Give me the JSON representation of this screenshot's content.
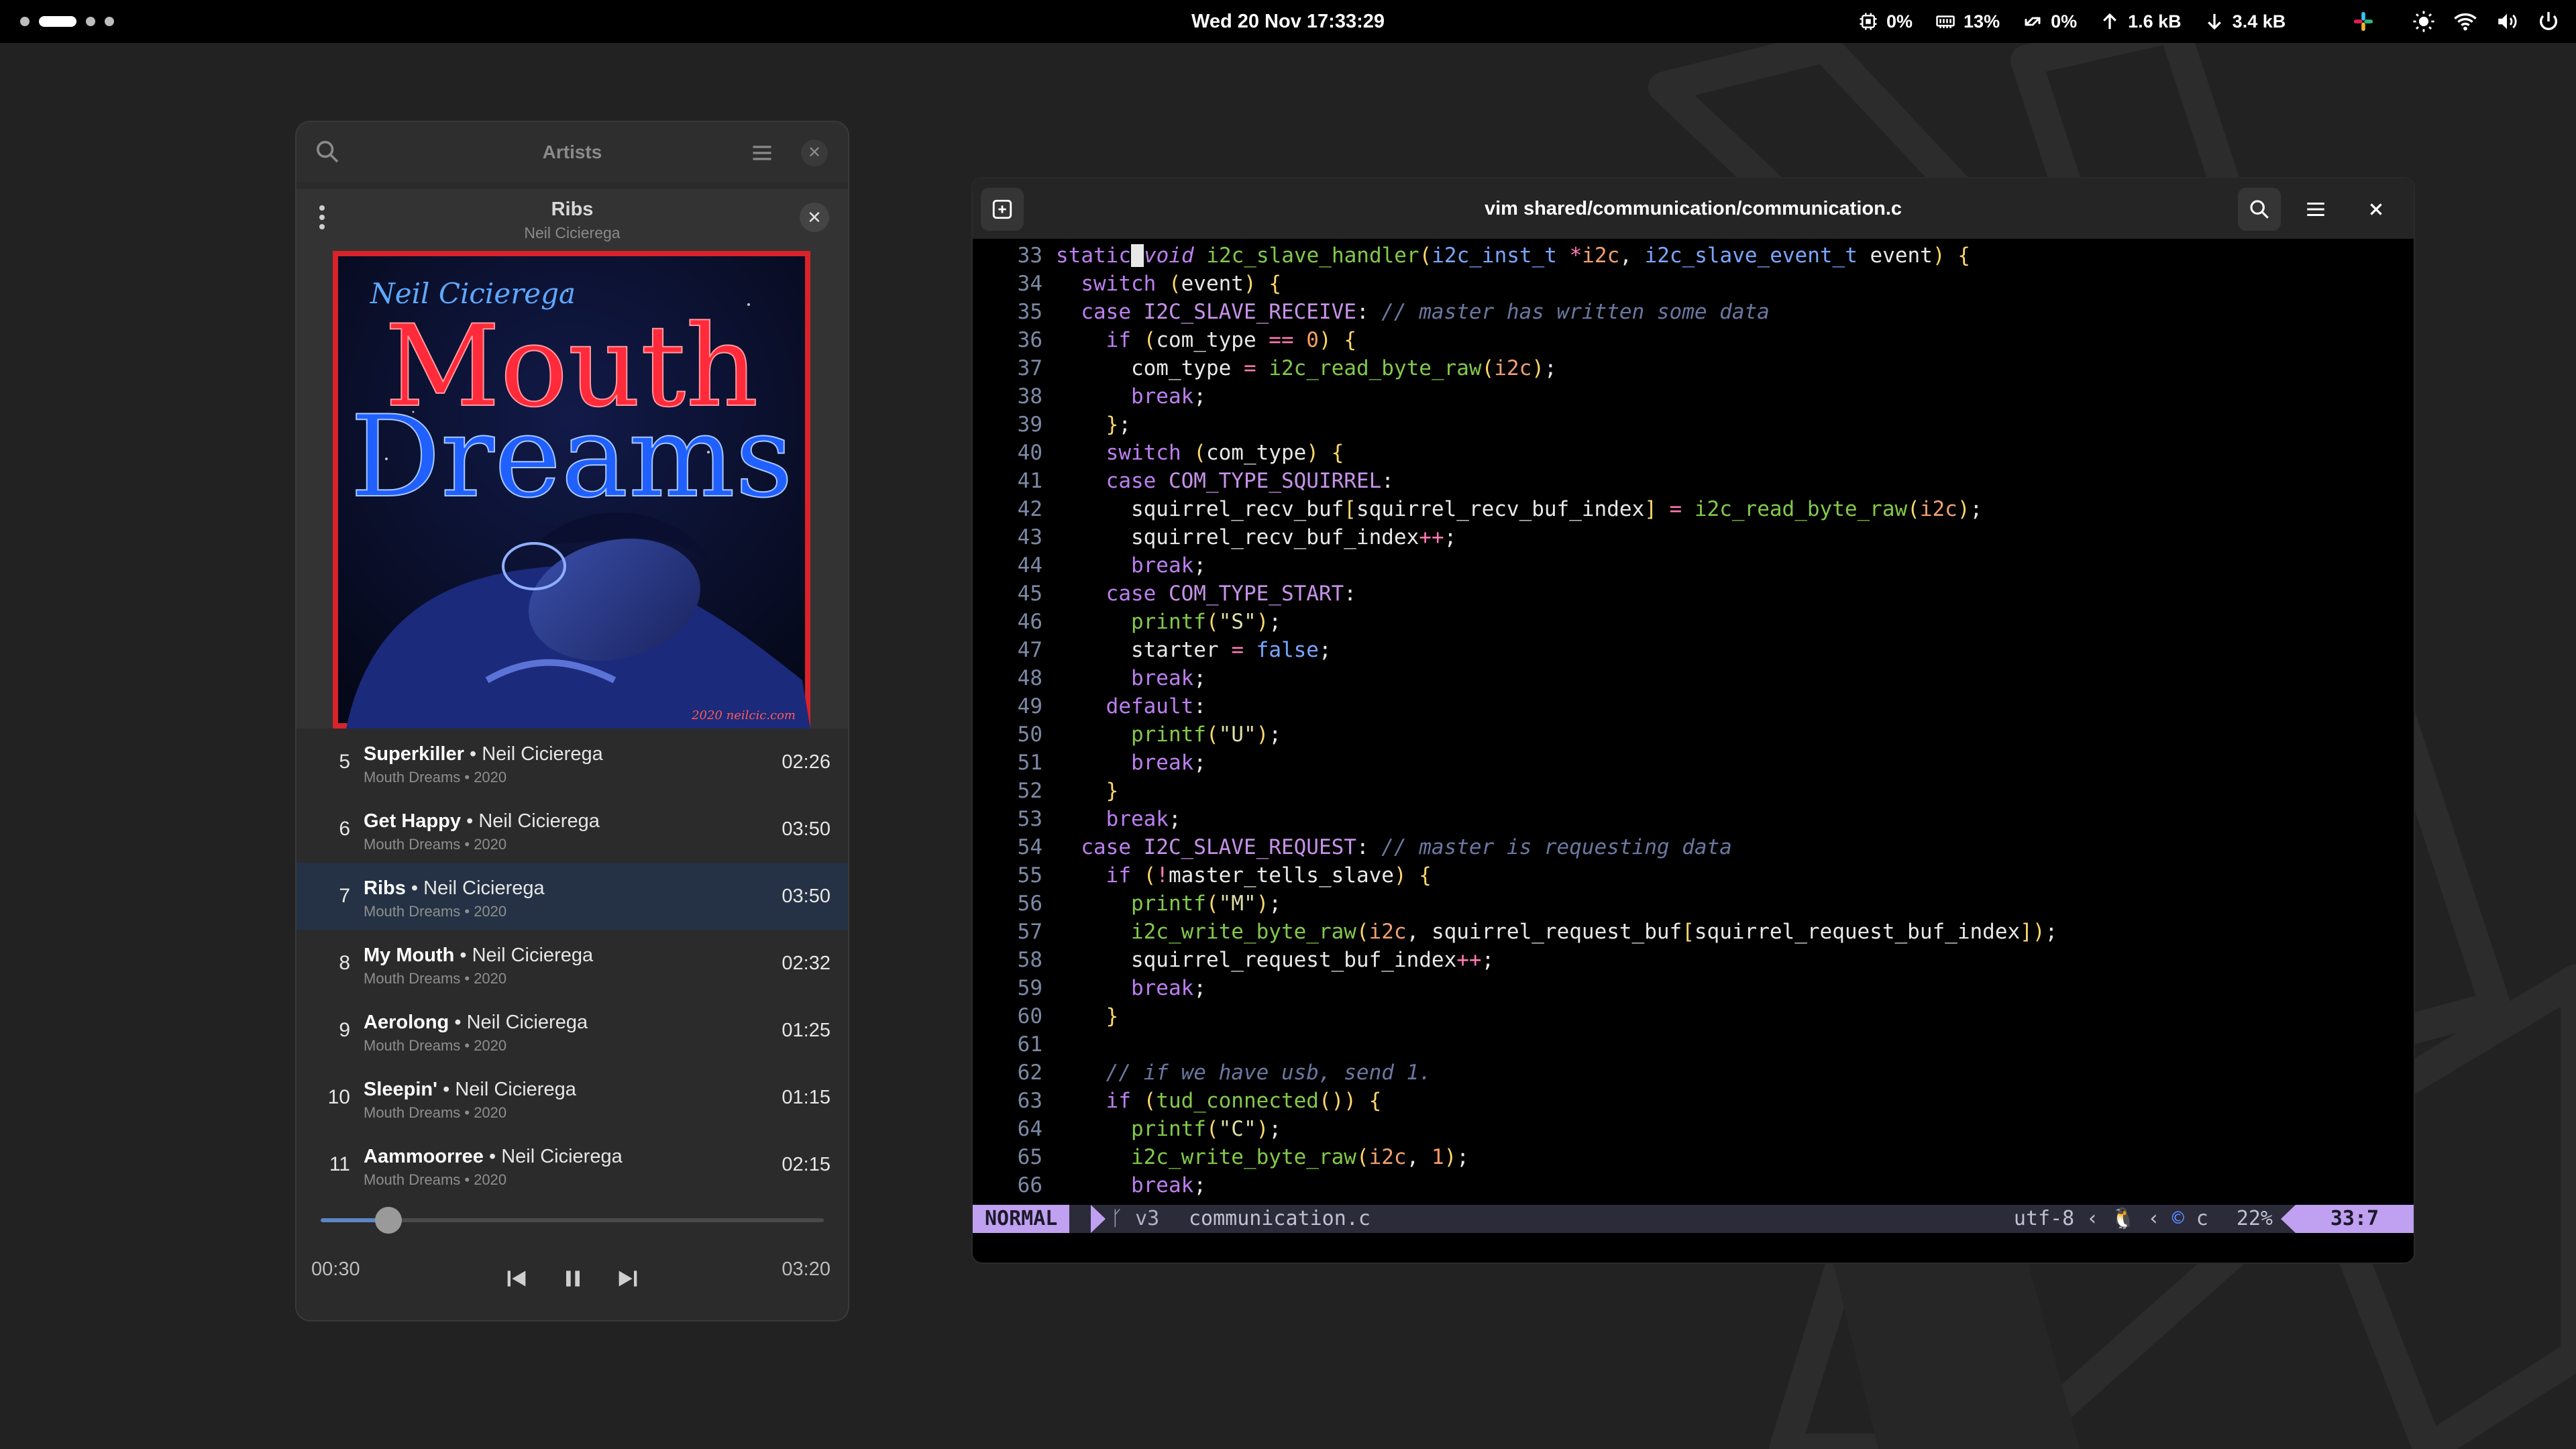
{
  "topbar": {
    "clock": "Wed 20 Nov  17:33:29",
    "cpu": "0%",
    "memory": "13%",
    "swap": "0%",
    "net_up": "1.6 kB",
    "net_down": "3.4 kB"
  },
  "player": {
    "header_title": "Artists",
    "now_playing": {
      "title": "Ribs",
      "artist": "Neil Cicierega"
    },
    "cover": {
      "artist_script": "Neil Cicierega",
      "title_line1": "Mouth",
      "title_line2": "Dreams",
      "credit": "2020 neilcic.com"
    },
    "tracks": [
      {
        "num": "5",
        "title": "Superkiller",
        "artist": "Neil Cicierega",
        "sub": "Mouth Dreams • 2020",
        "duration": "02:26"
      },
      {
        "num": "6",
        "title": "Get Happy",
        "artist": "Neil Cicierega",
        "sub": "Mouth Dreams • 2020",
        "duration": "03:50"
      },
      {
        "num": "7",
        "title": "Ribs",
        "artist": "Neil Cicierega",
        "sub": "Mouth Dreams • 2020",
        "duration": "03:50"
      },
      {
        "num": "8",
        "title": "My Mouth",
        "artist": "Neil Cicierega",
        "sub": "Mouth Dreams • 2020",
        "duration": "02:32"
      },
      {
        "num": "9",
        "title": "Aerolong",
        "artist": "Neil Cicierega",
        "sub": "Mouth Dreams • 2020",
        "duration": "01:25"
      },
      {
        "num": "10",
        "title": "Sleepin'",
        "artist": "Neil Cicierega",
        "sub": "Mouth Dreams • 2020",
        "duration": "01:15"
      },
      {
        "num": "11",
        "title": "Aammoorree",
        "artist": "Neil Cicierega",
        "sub": "Mouth Dreams • 2020",
        "duration": "02:15"
      }
    ],
    "active_track_index": 2,
    "elapsed": "00:30",
    "total": "03:20",
    "progress_fraction": 0.135
  },
  "terminal": {
    "title": "vim shared/communication/communication.c",
    "line_numbers": [
      "33",
      "34",
      "35",
      "36",
      "37",
      "38",
      "39",
      "40",
      "41",
      "42",
      "43",
      "44",
      "45",
      "46",
      "47",
      "48",
      "49",
      "50",
      "51",
      "52",
      "53",
      "54",
      "55",
      "56",
      "57",
      "58",
      "59",
      "60",
      "61",
      "62",
      "63",
      "64",
      "65",
      "66"
    ],
    "code_lines": [
      "static void i2c_slave_handler(i2c_inst_t *i2c, i2c_slave_event_t event) {",
      "  switch (event) {",
      "  case I2C_SLAVE_RECEIVE: // master has written some data",
      "    if (com_type == 0) {",
      "      com_type = i2c_read_byte_raw(i2c);",
      "      break;",
      "    };",
      "    switch (com_type) {",
      "    case COM_TYPE_SQUIRREL:",
      "      squirrel_recv_buf[squirrel_recv_buf_index] = i2c_read_byte_raw(i2c);",
      "      squirrel_recv_buf_index++;",
      "      break;",
      "    case COM_TYPE_START:",
      "      printf(\"S\");",
      "      starter = false;",
      "      break;",
      "    default:",
      "      printf(\"U\");",
      "      break;",
      "    }",
      "    break;",
      "  case I2C_SLAVE_REQUEST: // master is requesting data",
      "    if (!master_tells_slave) {",
      "      printf(\"M\");",
      "      i2c_write_byte_raw(i2c, squirrel_request_buf[squirrel_request_buf_index]);",
      "      squirrel_request_buf_index++;",
      "      break;",
      "    }",
      "",
      "    // if we have usb, send 1.",
      "    if (tud_connected()) {",
      "      printf(\"C\");",
      "      i2c_write_byte_raw(i2c, 1);",
      "      break;"
    ],
    "status": {
      "mode": "NORMAL",
      "branch": "v3",
      "file": "communication.c",
      "encoding": "utf-8",
      "filetype": "c",
      "percent": "22%",
      "position": "33:7"
    }
  }
}
